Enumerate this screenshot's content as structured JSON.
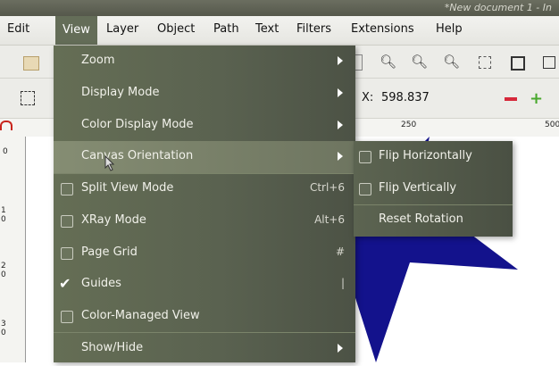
{
  "titlebar": {
    "text": "*New document 1 - In"
  },
  "menubar": {
    "items": [
      {
        "label": "Edit"
      },
      {
        "label": "View"
      },
      {
        "label": "Layer"
      },
      {
        "label": "Object"
      },
      {
        "label": "Path"
      },
      {
        "label": "Text"
      },
      {
        "label": "Filters"
      },
      {
        "label": "Extensions"
      },
      {
        "label": "Help"
      }
    ]
  },
  "toolbar2": {
    "x_label": "X:",
    "x_value": "598.837"
  },
  "ruler": {
    "h_ticks": [
      "250",
      "500"
    ],
    "v_ticks": [
      "0",
      "1 0",
      "2 0",
      "3 0"
    ]
  },
  "view_menu": {
    "items": [
      {
        "label": "Zoom",
        "submenu": true
      },
      {
        "label": "Display Mode",
        "submenu": true
      },
      {
        "label": "Color Display Mode",
        "submenu": true
      },
      {
        "label": "Canvas Orientation",
        "submenu": true,
        "highlighted": true
      },
      {
        "label": "Split View Mode",
        "checkbox": true,
        "checked": false,
        "shortcut": "Ctrl+6"
      },
      {
        "label": "XRay Mode",
        "checkbox": true,
        "checked": false,
        "shortcut": "Alt+6"
      },
      {
        "label": "Page Grid",
        "checkbox": true,
        "checked": false,
        "shortcut": "#"
      },
      {
        "label": "Guides",
        "checkbox": true,
        "checked": true,
        "shortcut": "|"
      },
      {
        "label": "Color-Managed View",
        "checkbox": true,
        "checked": false
      },
      {
        "label": "Show/Hide",
        "submenu": true
      }
    ]
  },
  "orientation_submenu": {
    "items": [
      {
        "label": "Flip Horizontally",
        "checkbox": true
      },
      {
        "label": "Flip Vertically",
        "checkbox": true
      },
      {
        "label": "Reset Rotation",
        "checkbox": false
      }
    ]
  },
  "colors": {
    "menu_bg": "#5d6552",
    "menu_highlight": "#7d8569",
    "star": "#13128c"
  }
}
